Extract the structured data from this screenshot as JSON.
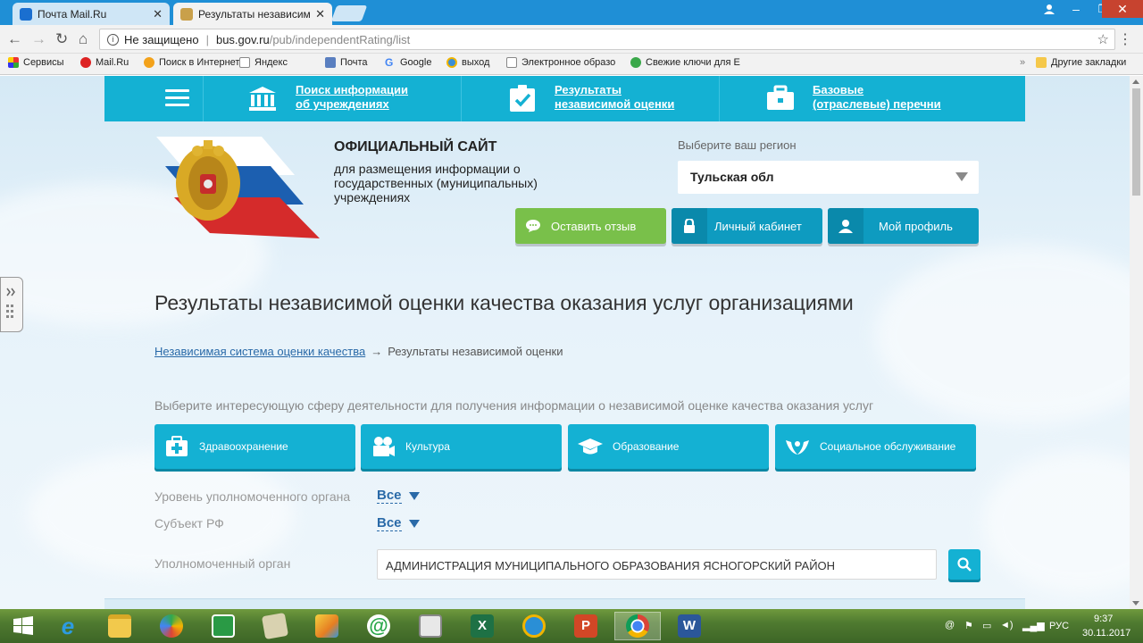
{
  "browser": {
    "tabs": [
      {
        "label": "Почта Mail.Ru",
        "active": false
      },
      {
        "label": "Результаты независимо",
        "active": true
      }
    ],
    "address": {
      "security": "Не защищено",
      "host": "bus.gov.ru",
      "path": "/pub/independentRating/list"
    },
    "bookmarks": [
      "Сервисы",
      "Mail.Ru",
      "Поиск в Интернете",
      "Яндекс",
      "Почта",
      "Google",
      "выход",
      "Электронное образо",
      "Свежие ключи для Е"
    ],
    "other_bookmarks": "Другие закладки",
    "window_controls": [
      "–",
      "❐",
      "✕"
    ]
  },
  "site": {
    "nav": [
      {
        "line1": "Поиск информации",
        "line2": "об учреждениях"
      },
      {
        "line1": "Результаты",
        "line2": "независимой оценки"
      },
      {
        "line1": "Базовые",
        "line2": "(отраслевые) перечни"
      }
    ],
    "title": "ОФИЦИАЛЬНЫЙ САЙТ",
    "subtitle": "для размещения информации о государственных (муниципальных) учреждениях",
    "region_label": "Выберите ваш регион",
    "region_value": "Тульская обл",
    "buttons": {
      "feedback": "Оставить отзыв",
      "cabinet": "Личный кабинет",
      "profile": "Мой профиль"
    }
  },
  "main": {
    "heading": "Результаты независимой оценки качества оказания услуг организациями",
    "breadcrumb": {
      "link": "Независимая система оценки качества",
      "arrow": "→",
      "current": "Результаты независимой оценки"
    },
    "intro": "Выберите интересующую сферу деятельности для получения информации о независимой оценке качества оказания услуг",
    "spheres": [
      "Здравоохранение",
      "Культура",
      "Образование",
      "Социальное обслуживание"
    ],
    "filters": {
      "level_label": "Уровень уполномоченного органа",
      "level_value": "Все",
      "subject_label": "Субъект РФ",
      "subject_value": "Все",
      "org_label": "Уполномоченный орган",
      "org_value": "АДМИНИСТРАЦИЯ МУНИЦИПАЛЬНОГО ОБРАЗОВАНИЯ ЯСНОГОРСКИЙ РАЙОН"
    }
  },
  "taskbar": {
    "apps": [
      "start",
      "internet-explorer",
      "file-explorer",
      "media-player",
      "store",
      "notepad",
      "paint",
      "mail-agent",
      "calculator",
      "excel",
      "mail-ru",
      "powerpoint",
      "chrome",
      "word"
    ],
    "tray": {
      "lang": "РУС",
      "time": "9:37",
      "date": "30.11.2017"
    }
  },
  "colors": {
    "accent": "#14b1d3",
    "green": "#79c04a",
    "link": "#2a6aa8",
    "chrome_blue": "#1f8fd6"
  }
}
